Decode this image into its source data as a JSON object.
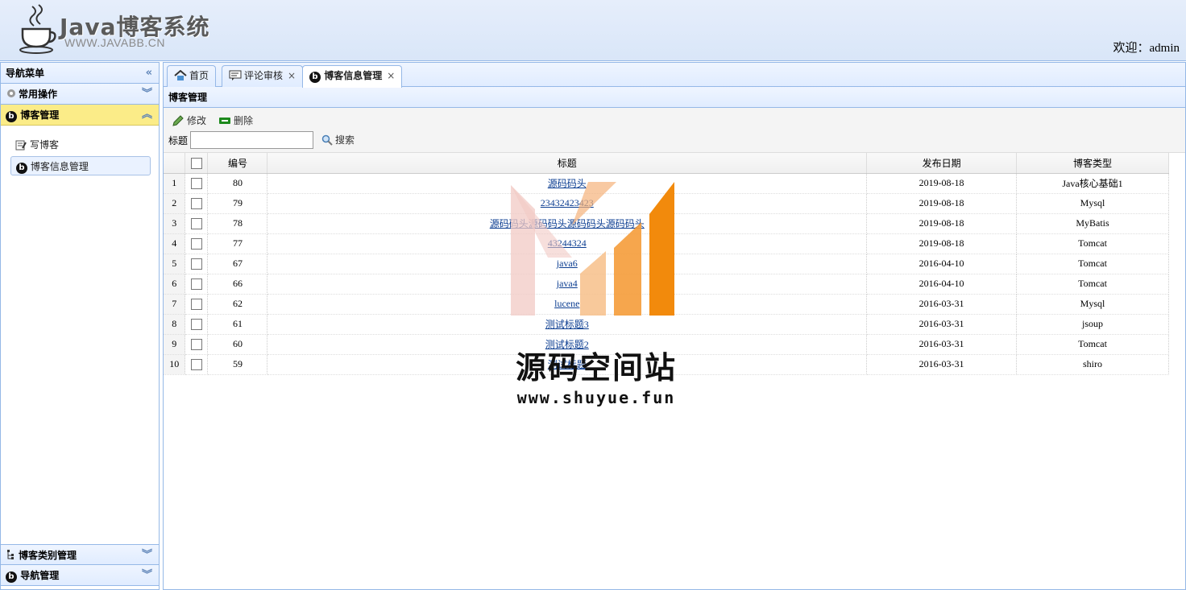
{
  "header": {
    "title": "Java博客系统",
    "subtitle": "WWW.JAVABB.CN",
    "welcome": "欢迎：admin"
  },
  "nav": {
    "title": "导航菜单",
    "sections": [
      {
        "label": "常用操作",
        "icon": "gear-icon"
      },
      {
        "label": "博客管理",
        "icon": "blog-icon"
      },
      {
        "label": "博客类别管理",
        "icon": "tree-icon"
      },
      {
        "label": "导航管理",
        "icon": "blog-icon"
      }
    ],
    "items": [
      {
        "label": "写博客",
        "icon": "edit-icon"
      },
      {
        "label": "博客信息管理",
        "icon": "blog-icon"
      }
    ]
  },
  "tabs": [
    {
      "label": "首页",
      "icon": "home-icon"
    },
    {
      "label": "评论审核",
      "icon": "comment-icon"
    },
    {
      "label": "博客信息管理",
      "icon": "blog-icon"
    }
  ],
  "panel": {
    "title": "博客管理",
    "edit_label": "修改",
    "delete_label": "删除",
    "search_label": "标题",
    "search_value": "",
    "search_button": "搜索"
  },
  "grid": {
    "columns": [
      "编号",
      "标题",
      "发布日期",
      "博客类型"
    ],
    "rows": [
      {
        "n": "1",
        "id": "80",
        "title": "源码码头",
        "date": "2019-08-18",
        "type": "Java核心基础1"
      },
      {
        "n": "2",
        "id": "79",
        "title": "23432423423",
        "date": "2019-08-18",
        "type": "Mysql"
      },
      {
        "n": "3",
        "id": "78",
        "title": "源码码头源码码头源码码头源码码头",
        "date": "2019-08-18",
        "type": "MyBatis"
      },
      {
        "n": "4",
        "id": "77",
        "title": "43244324",
        "date": "2019-08-18",
        "type": "Tomcat"
      },
      {
        "n": "5",
        "id": "67",
        "title": "java6",
        "date": "2016-04-10",
        "type": "Tomcat"
      },
      {
        "n": "6",
        "id": "66",
        "title": "java4",
        "date": "2016-04-10",
        "type": "Tomcat"
      },
      {
        "n": "7",
        "id": "62",
        "title": "lucene",
        "date": "2016-03-31",
        "type": "Mysql"
      },
      {
        "n": "8",
        "id": "61",
        "title": "测试标题3",
        "date": "2016-03-31",
        "type": "jsoup"
      },
      {
        "n": "9",
        "id": "60",
        "title": "测试标题2",
        "date": "2016-03-31",
        "type": "Tomcat"
      },
      {
        "n": "10",
        "id": "59",
        "title": "测试标题",
        "date": "2016-03-31",
        "type": "shiro"
      }
    ]
  },
  "watermark": {
    "text": "源码空间站",
    "url": "www.shuyue.fun"
  }
}
